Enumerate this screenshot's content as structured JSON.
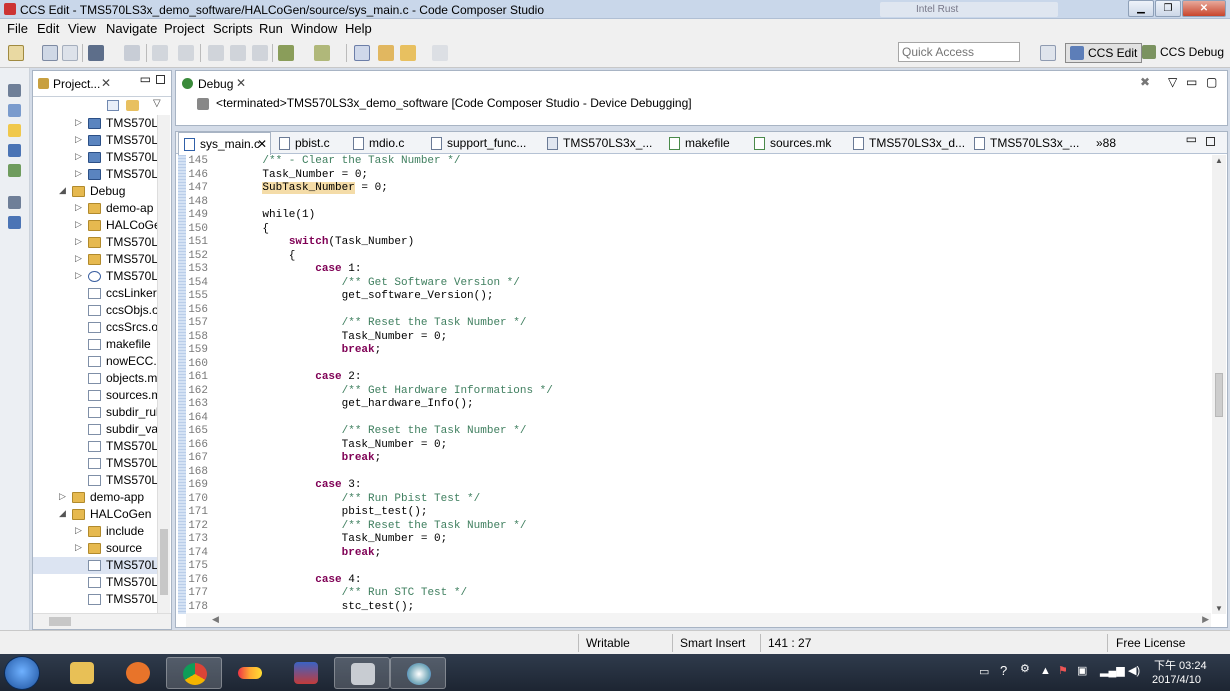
{
  "window": {
    "title": "CCS Edit - TMS570LS3x_demo_software/HALCoGen/source/sys_main.c - Code Composer Studio",
    "blurred_tab": "Intel Rust"
  },
  "menu": [
    "File",
    "Edit",
    "View",
    "Navigate",
    "Project",
    "Scripts",
    "Run",
    "Window",
    "Help"
  ],
  "toolbar": {
    "quick_access_placeholder": "Quick Access",
    "perspectives": [
      "CCS Edit",
      "CCS Debug"
    ]
  },
  "explorer": {
    "tab_label": "Project...",
    "items": [
      {
        "label": "TMS570L",
        "type": "proj"
      },
      {
        "label": "TMS570L",
        "type": "proj"
      },
      {
        "label": "TMS570L",
        "type": "proj"
      },
      {
        "label": "TMS570L",
        "type": "proj"
      },
      {
        "label": "Debug",
        "type": "folder"
      },
      {
        "label": "demo-ap",
        "type": "folder"
      },
      {
        "label": "HALCoGe",
        "type": "folder"
      },
      {
        "label": "TMS570L",
        "type": "folder"
      },
      {
        "label": "TMS570L",
        "type": "folder"
      },
      {
        "label": "TMS570L",
        "type": "bin"
      },
      {
        "label": "ccsLinker.",
        "type": "file"
      },
      {
        "label": "ccsObjs.o",
        "type": "file"
      },
      {
        "label": "ccsSrcs.op",
        "type": "file"
      },
      {
        "label": "makefile",
        "type": "file"
      },
      {
        "label": "nowECC.l",
        "type": "file"
      },
      {
        "label": "objects.m",
        "type": "file"
      },
      {
        "label": "sources.m",
        "type": "file"
      },
      {
        "label": "subdir_rul",
        "type": "file"
      },
      {
        "label": "subdir_va",
        "type": "file"
      },
      {
        "label": "TMS570LS",
        "type": "file"
      },
      {
        "label": "TMS570L",
        "type": "file"
      },
      {
        "label": "TMS570L",
        "type": "file"
      },
      {
        "label": "demo-app",
        "type": "folder"
      },
      {
        "label": "HALCoGen",
        "type": "folder"
      },
      {
        "label": "include",
        "type": "folder"
      },
      {
        "label": "source",
        "type": "folder"
      },
      {
        "label": "TMS570L",
        "type": "file"
      },
      {
        "label": "TMS570L",
        "type": "file"
      },
      {
        "label": "TMS570L",
        "type": "file"
      }
    ]
  },
  "debug_view": {
    "tab_label": "Debug",
    "session": "<terminated>TMS570LS3x_demo_software [Code Composer Studio - Device Debugging]"
  },
  "editor": {
    "tabs": [
      "sys_main.c",
      "pbist.c",
      "mdio.c",
      "support_func...",
      "TMS570LS3x_...",
      "makefile",
      "sources.mk",
      "TMS570LS3x_d...",
      "TMS570LS3x_..."
    ],
    "more_tabs": "»88",
    "lines": [
      {
        "n": "145",
        "segs": [
          {
            "t": "    "
          },
          {
            "t": "/** - Clear the Task Number */",
            "c": "cm"
          }
        ]
      },
      {
        "n": "146",
        "segs": [
          {
            "t": "    Task_Number = 0;"
          }
        ]
      },
      {
        "n": "147",
        "segs": [
          {
            "t": "    "
          },
          {
            "t": "SubTask_Number",
            "c": "hl"
          },
          {
            "t": " = 0;"
          }
        ]
      },
      {
        "n": "148",
        "segs": []
      },
      {
        "n": "149",
        "segs": [
          {
            "t": "    while(1)"
          }
        ]
      },
      {
        "n": "150",
        "segs": [
          {
            "t": "    {"
          }
        ]
      },
      {
        "n": "151",
        "segs": [
          {
            "t": "        "
          },
          {
            "t": "switch",
            "c": "kw"
          },
          {
            "t": "(Task_Number)"
          }
        ]
      },
      {
        "n": "152",
        "segs": [
          {
            "t": "        {"
          }
        ]
      },
      {
        "n": "153",
        "segs": [
          {
            "t": "            "
          },
          {
            "t": "case",
            "c": "kw"
          },
          {
            "t": " 1:"
          }
        ]
      },
      {
        "n": "154",
        "segs": [
          {
            "t": "                "
          },
          {
            "t": "/** Get Software Version */",
            "c": "cm"
          }
        ]
      },
      {
        "n": "155",
        "segs": [
          {
            "t": "                get_software_Version();"
          }
        ]
      },
      {
        "n": "156",
        "segs": []
      },
      {
        "n": "157",
        "segs": [
          {
            "t": "                "
          },
          {
            "t": "/** Reset the Task Number */",
            "c": "cm"
          }
        ]
      },
      {
        "n": "158",
        "segs": [
          {
            "t": "                Task_Number = 0;"
          }
        ]
      },
      {
        "n": "159",
        "segs": [
          {
            "t": "                "
          },
          {
            "t": "break",
            "c": "kw"
          },
          {
            "t": ";"
          }
        ]
      },
      {
        "n": "160",
        "segs": []
      },
      {
        "n": "161",
        "segs": [
          {
            "t": "            "
          },
          {
            "t": "case",
            "c": "kw"
          },
          {
            "t": " 2:"
          }
        ]
      },
      {
        "n": "162",
        "segs": [
          {
            "t": "                "
          },
          {
            "t": "/** Get Hardware Informations */",
            "c": "cm"
          }
        ]
      },
      {
        "n": "163",
        "segs": [
          {
            "t": "                get_hardware_Info();"
          }
        ]
      },
      {
        "n": "164",
        "segs": []
      },
      {
        "n": "165",
        "segs": [
          {
            "t": "                "
          },
          {
            "t": "/** Reset the Task Number */",
            "c": "cm"
          }
        ]
      },
      {
        "n": "166",
        "segs": [
          {
            "t": "                Task_Number = 0;"
          }
        ]
      },
      {
        "n": "167",
        "segs": [
          {
            "t": "                "
          },
          {
            "t": "break",
            "c": "kw"
          },
          {
            "t": ";"
          }
        ]
      },
      {
        "n": "168",
        "segs": []
      },
      {
        "n": "169",
        "segs": [
          {
            "t": "            "
          },
          {
            "t": "case",
            "c": "kw"
          },
          {
            "t": " 3:"
          }
        ]
      },
      {
        "n": "170",
        "segs": [
          {
            "t": "                "
          },
          {
            "t": "/** Run Pbist Test */",
            "c": "cm"
          }
        ]
      },
      {
        "n": "171",
        "segs": [
          {
            "t": "                pbist_test();"
          }
        ]
      },
      {
        "n": "172",
        "segs": [
          {
            "t": "                "
          },
          {
            "t": "/** Reset the Task Number */",
            "c": "cm"
          }
        ]
      },
      {
        "n": "173",
        "segs": [
          {
            "t": "                Task_Number = 0;"
          }
        ]
      },
      {
        "n": "174",
        "segs": [
          {
            "t": "                "
          },
          {
            "t": "break",
            "c": "kw"
          },
          {
            "t": ";"
          }
        ]
      },
      {
        "n": "175",
        "segs": []
      },
      {
        "n": "176",
        "segs": [
          {
            "t": "            "
          },
          {
            "t": "case",
            "c": "kw"
          },
          {
            "t": " 4:"
          }
        ]
      },
      {
        "n": "177",
        "segs": [
          {
            "t": "                "
          },
          {
            "t": "/** Run STC Test */",
            "c": "cm"
          }
        ]
      },
      {
        "n": "178",
        "segs": [
          {
            "t": "                stc_test();"
          }
        ]
      }
    ]
  },
  "status": {
    "mode": "Writable",
    "insert": "Smart Insert",
    "position": "141 : 27",
    "license": "Free License"
  },
  "taskbar": {
    "time": "下午 03:24",
    "date": "2017/4/10"
  }
}
